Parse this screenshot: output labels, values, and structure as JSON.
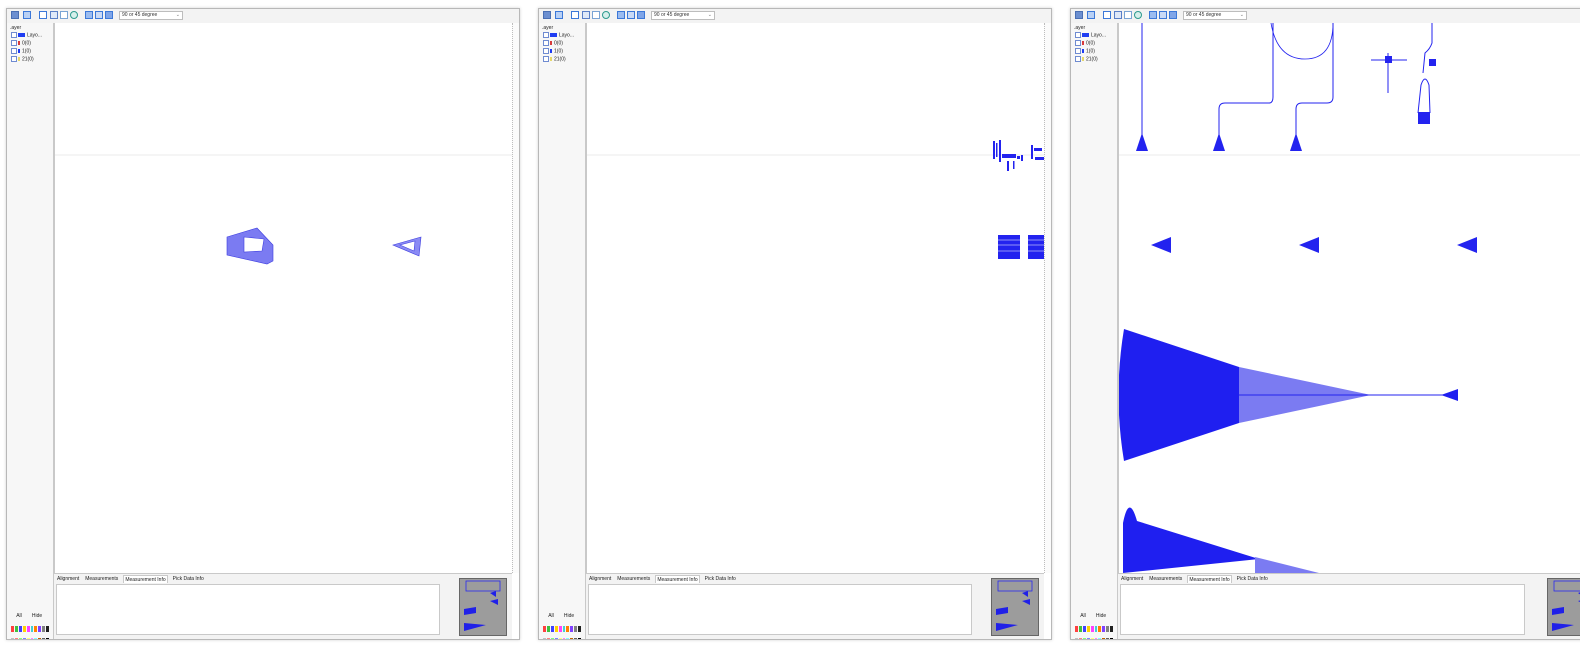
{
  "windows": [
    {
      "id": "left",
      "toolbar": {
        "snap_value": "90 or 45 degree"
      },
      "layer_panel": {
        "title": ".ayer",
        "rows": [
          {
            "label": "Layo...",
            "color": "#1f3df2"
          },
          {
            "label": "0(0)",
            "color": "#d83b3b"
          },
          {
            "label": "1(0)",
            "color": "#1f3df2"
          },
          {
            "label": "21(0)",
            "color": "#e8d86a"
          }
        ],
        "all_label": "All",
        "hide_label": "Hide"
      },
      "tabs": [
        "Alignment",
        "Measurements",
        "Measurement Info",
        "Pick Data Info"
      ],
      "active_tab": "Measurement Info"
    },
    {
      "id": "middle",
      "toolbar": {
        "snap_value": "90 or 45 degree"
      },
      "layer_panel": {
        "title": ".ayer",
        "rows": [
          {
            "label": "Layo...",
            "color": "#1f3df2"
          },
          {
            "label": "0(0)",
            "color": "#d83b3b"
          },
          {
            "label": "1(0)",
            "color": "#1f3df2"
          },
          {
            "label": "21(0)",
            "color": "#e8d86a"
          }
        ],
        "all_label": "All",
        "hide_label": "Hide"
      },
      "tabs": [
        "Alignment",
        "Measurements",
        "Measurement Info",
        "Pick Data Info"
      ],
      "active_tab": "Measurement Info"
    },
    {
      "id": "right",
      "toolbar": {
        "snap_value": "90 or 45 degree"
      },
      "layer_panel": {
        "title": ".ayer",
        "rows": [
          {
            "label": "Layo...",
            "color": "#1f3df2"
          },
          {
            "label": "0(0)",
            "color": "#d83b3b"
          },
          {
            "label": "1(0)",
            "color": "#1f3df2"
          },
          {
            "label": "21(0)",
            "color": "#e8d86a"
          }
        ],
        "all_label": "All",
        "hide_label": "Hide"
      },
      "tabs": [
        "Alignment",
        "Measurements",
        "Measurement Info",
        "Pick Data Info"
      ],
      "active_tab": "Measurement Info"
    }
  ],
  "colors": {
    "layer_blue": "#1f1ff0",
    "layer_light_blue": "#7b7bf2",
    "palette": [
      "#ff4040",
      "#40c040",
      "#4040ff",
      "#ffd000",
      "#ff40ff",
      "#40d0d0",
      "#ff8000",
      "#8040ff",
      "#808080",
      "#202020",
      "#c0c0c0",
      "#ff8080",
      "#80ff80",
      "#8080ff",
      "#ffff80",
      "#ff80ff",
      "#80ffff",
      "#c06000",
      "#606060",
      "#000000"
    ]
  }
}
